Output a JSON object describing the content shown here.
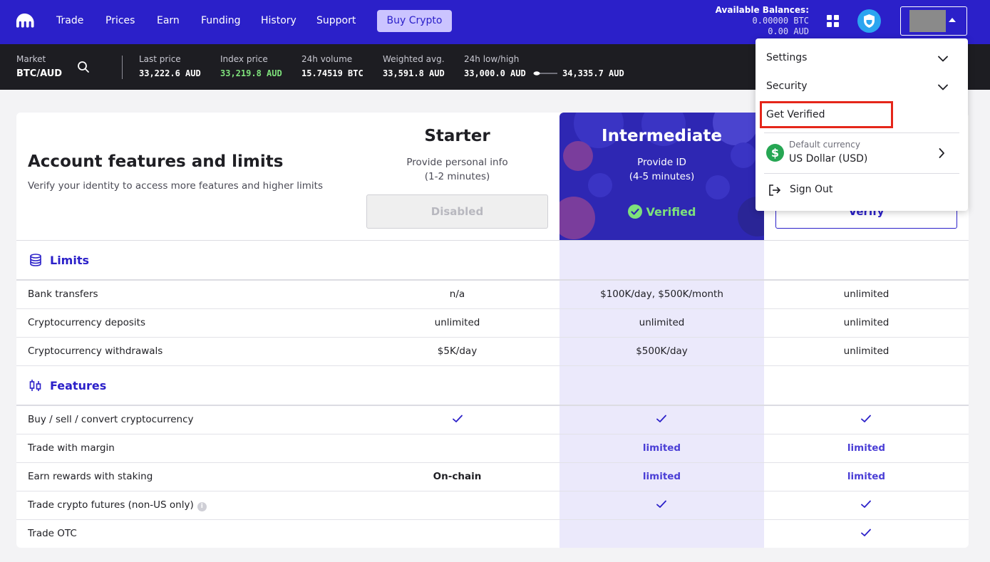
{
  "nav": {
    "items": [
      "Trade",
      "Prices",
      "Earn",
      "Funding",
      "History",
      "Support"
    ],
    "buy_crypto": "Buy Crypto",
    "balances_title": "Available Balances:",
    "balance_btc": "0.00000 BTC",
    "balance_aud": "0.00 AUD"
  },
  "ticker": {
    "market_label": "Market",
    "market_value": "BTC/AUD",
    "last_price_label": "Last price",
    "last_price_value": "33,222.6 AUD",
    "index_price_label": "Index price",
    "index_price_value": "33,219.8 AUD",
    "volume_label": "24h volume",
    "volume_value": "15.74519 BTC",
    "wavg_label": "Weighted avg.",
    "wavg_value": "33,591.8 AUD",
    "lowhigh_label": "24h low/high",
    "low_value": "33,000.0 AUD",
    "high_value": "34,335.7 AUD"
  },
  "page": {
    "title": "Account features and limits",
    "subtitle": "Verify your identity to access more features and higher limits"
  },
  "tiers": {
    "starter": {
      "name": "Starter",
      "desc1": "Provide personal info",
      "desc2": "(1-2 minutes)",
      "button": "Disabled"
    },
    "intermediate": {
      "name": "Intermediate",
      "desc1": "Provide ID",
      "desc2": "(4-5 minutes)",
      "status": "Verified"
    },
    "pro": {
      "button": "Verify"
    }
  },
  "sections": {
    "limits": "Limits",
    "features": "Features"
  },
  "limits_rows": [
    {
      "label": "Bank transfers",
      "starter": "n/a",
      "intermediate": "$100K/day, $500K/month",
      "pro": "unlimited"
    },
    {
      "label": "Cryptocurrency deposits",
      "starter": "unlimited",
      "intermediate": "unlimited",
      "pro": "unlimited"
    },
    {
      "label": "Cryptocurrency withdrawals",
      "starter": "$5K/day",
      "intermediate": "$500K/day",
      "pro": "unlimited"
    }
  ],
  "features_rows": [
    {
      "label": "Buy / sell / convert cryptocurrency",
      "starter": "check",
      "intermediate": "check",
      "pro": "check"
    },
    {
      "label": "Trade with margin",
      "starter": "",
      "intermediate": "limited",
      "pro": "limited"
    },
    {
      "label": "Earn rewards with staking",
      "starter": "On-chain",
      "intermediate": "limited",
      "pro": "limited"
    },
    {
      "label": "Trade crypto futures (non-US only)",
      "starter": "",
      "intermediate": "check",
      "pro": "check"
    },
    {
      "label": "Trade OTC",
      "starter": "",
      "intermediate": "",
      "pro": "check"
    }
  ],
  "dropdown": {
    "settings": "Settings",
    "security": "Security",
    "get_verified": "Get Verified",
    "default_currency_label": "Default currency",
    "default_currency_value": "US Dollar (USD)",
    "sign_out": "Sign Out"
  },
  "colors": {
    "brand": "#2b20c9",
    "ticker_bg": "#1d1d22",
    "highlight_col": "#ebe9fb",
    "verified": "#7ee17b",
    "index_price": "#7ee17b",
    "annotation_box": "#e5261a"
  }
}
